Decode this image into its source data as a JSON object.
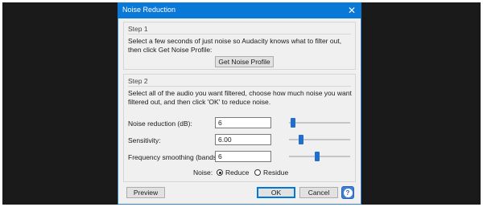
{
  "dialog": {
    "title": "Noise Reduction",
    "close_glyph": "✕"
  },
  "step1": {
    "legend": "Step 1",
    "line1": "Select a few seconds of just noise so Audacity knows what to filter out,",
    "line2": "then click Get Noise Profile:",
    "button": "Get Noise Profile"
  },
  "step2": {
    "legend": "Step 2",
    "line1": "Select all of the audio you want filtered, choose how much noise you want",
    "line2": "filtered out, and then click 'OK' to reduce noise.",
    "controls": [
      {
        "label": "Noise reduction (dB):",
        "value": "6",
        "slider_fraction": 0.06
      },
      {
        "label": "Sensitivity:",
        "value": "6.00",
        "slider_fraction": 0.2
      },
      {
        "label": "Frequency smoothing (bands):",
        "value": "6",
        "slider_fraction": 0.46
      }
    ],
    "noise": {
      "label": "Noise:",
      "option_reduce": "Reduce",
      "option_residue": "Residue",
      "selected": "Reduce"
    }
  },
  "footer": {
    "preview": "Preview",
    "ok": "OK",
    "cancel": "Cancel",
    "help_glyph": "?"
  },
  "colors": {
    "titlebar": "#0a78d7",
    "slider_thumb": "#1f6fd1",
    "help_button": "#3c7fd6"
  }
}
